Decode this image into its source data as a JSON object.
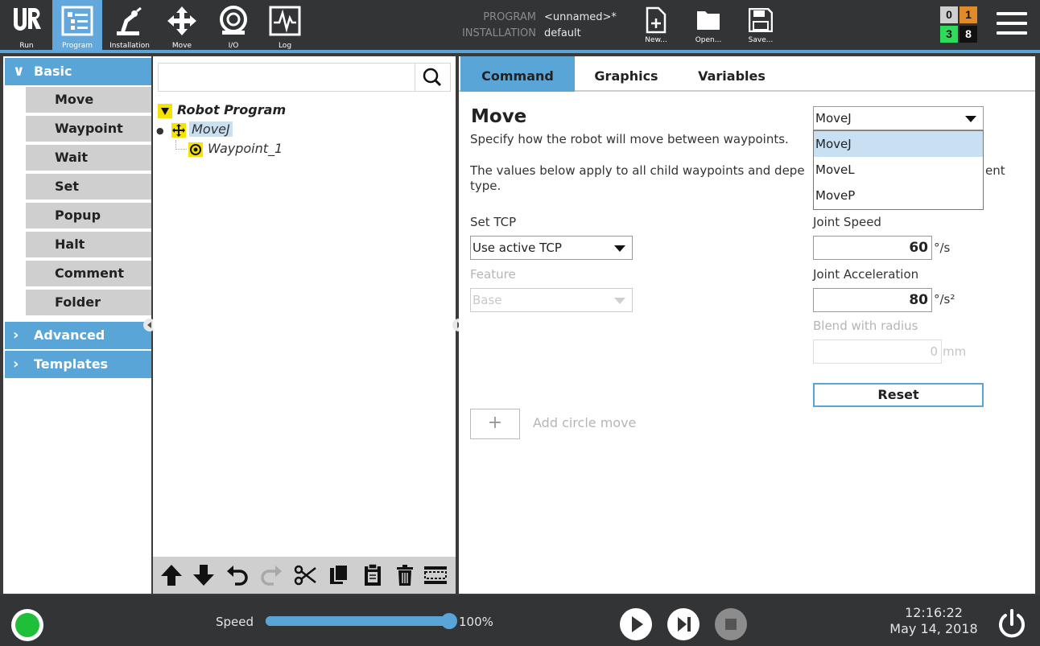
{
  "nav": {
    "items": [
      {
        "label": "Run",
        "icon": "ur-logo-icon"
      },
      {
        "label": "Program",
        "icon": "program-icon"
      },
      {
        "label": "Installation",
        "icon": "robot-arm-icon"
      },
      {
        "label": "Move",
        "icon": "move-arrows-icon"
      },
      {
        "label": "I/O",
        "icon": "io-icon"
      },
      {
        "label": "Log",
        "icon": "log-chart-icon"
      }
    ],
    "active": "Program"
  },
  "program_info": {
    "program_key": "PROGRAM",
    "program_value": "<unnamed>*",
    "installation_key": "INSTALLATION",
    "installation_value": "default"
  },
  "file": {
    "new_label": "New...",
    "open_label": "Open...",
    "save_label": "Save..."
  },
  "counters": {
    "top_left": "0",
    "top_right": "1",
    "bottom_left": "3",
    "bottom_right": "8",
    "colors": {
      "top_left": "#cfcfcf",
      "top_right": "#e08a2a",
      "bottom_left": "#2fdc5a",
      "bottom_right": "#111111"
    }
  },
  "left_panel": {
    "basic_label": "Basic",
    "basic_items": [
      "Move",
      "Waypoint",
      "Wait",
      "Set",
      "Popup",
      "Halt",
      "Comment",
      "Folder"
    ],
    "advanced_label": "Advanced",
    "templates_label": "Templates"
  },
  "tree": {
    "search_value": "",
    "root_label": "Robot Program",
    "movej_label": "MoveJ",
    "waypoint_label": "Waypoint_1"
  },
  "tabs": [
    "Command",
    "Graphics",
    "Variables"
  ],
  "command": {
    "title": "Move",
    "description": "Specify how the robot will move between waypoints.",
    "note_line1_visible": "The values below apply to all child waypoints and depe",
    "note_line1_tail": "ent",
    "note_line2": "type.",
    "move_type_selected": "MoveJ",
    "move_type_options": [
      "MoveJ",
      "MoveL",
      "MoveP"
    ],
    "set_tcp_label": "Set TCP",
    "set_tcp_value": "Use active TCP",
    "feature_label": "Feature",
    "feature_value": "Base",
    "joint_speed_label": "Joint Speed",
    "joint_speed_value": "60",
    "joint_speed_unit": "°/s",
    "joint_acc_label": "Joint Acceleration",
    "joint_acc_value": "80",
    "joint_acc_unit": "°/s²",
    "blend_label": "Blend with radius",
    "blend_value": "0",
    "blend_unit": "mm",
    "reset_label": "Reset",
    "add_circle_label": "Add circle move",
    "add_circle_symbol": "+"
  },
  "footer": {
    "speed_label": "Speed",
    "speed_value": "100%",
    "speed_fraction": 1.0,
    "time": "12:16:22",
    "date": "May 14, 2018",
    "status_color": "#1fbf3a"
  }
}
